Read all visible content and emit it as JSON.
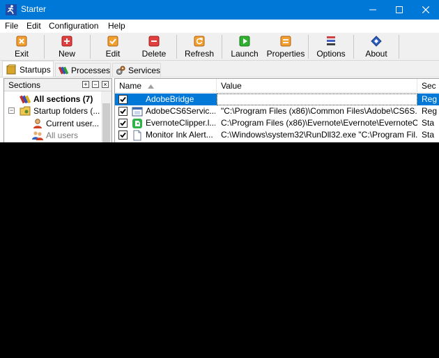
{
  "window": {
    "title": "Starter"
  },
  "menu": [
    "File",
    "Edit",
    "Configuration",
    "Help"
  ],
  "toolbar": {
    "exit": "Exit",
    "new": "New",
    "edit": "Edit",
    "delete": "Delete",
    "refresh": "Refresh",
    "launch": "Launch",
    "properties": "Properties",
    "options": "Options",
    "about": "About"
  },
  "tabs": [
    "Startups",
    "Processes",
    "Services"
  ],
  "sections": {
    "header": "Sections",
    "items": [
      {
        "label": "All sections (7)"
      },
      {
        "label": "Startup folders (..."
      },
      {
        "label": "Current user..."
      },
      {
        "label": "All users"
      }
    ]
  },
  "list": {
    "columns": [
      "Name",
      "Value",
      "Sec"
    ],
    "rows": [
      {
        "name": "AdobeBridge",
        "value": "",
        "section": "Reg",
        "checked": true
      },
      {
        "name": "AdobeCS6Servic...",
        "value": "\"C:\\Program Files (x86)\\Common Files\\Adobe\\CS6S...",
        "section": "Reg",
        "checked": true
      },
      {
        "name": "EvernoteClipper.l...",
        "value": "C:\\Program Files (x86)\\Evernote\\Evernote\\EvernoteC...",
        "section": "Sta",
        "checked": true
      },
      {
        "name": "Monitor Ink Alert...",
        "value": "C:\\Windows\\system32\\RunDll32.exe \"C:\\Program Fil...",
        "section": "Sta",
        "checked": true
      }
    ]
  },
  "colors": {
    "titlebar": "#0078d7",
    "selection": "#0078d7"
  }
}
